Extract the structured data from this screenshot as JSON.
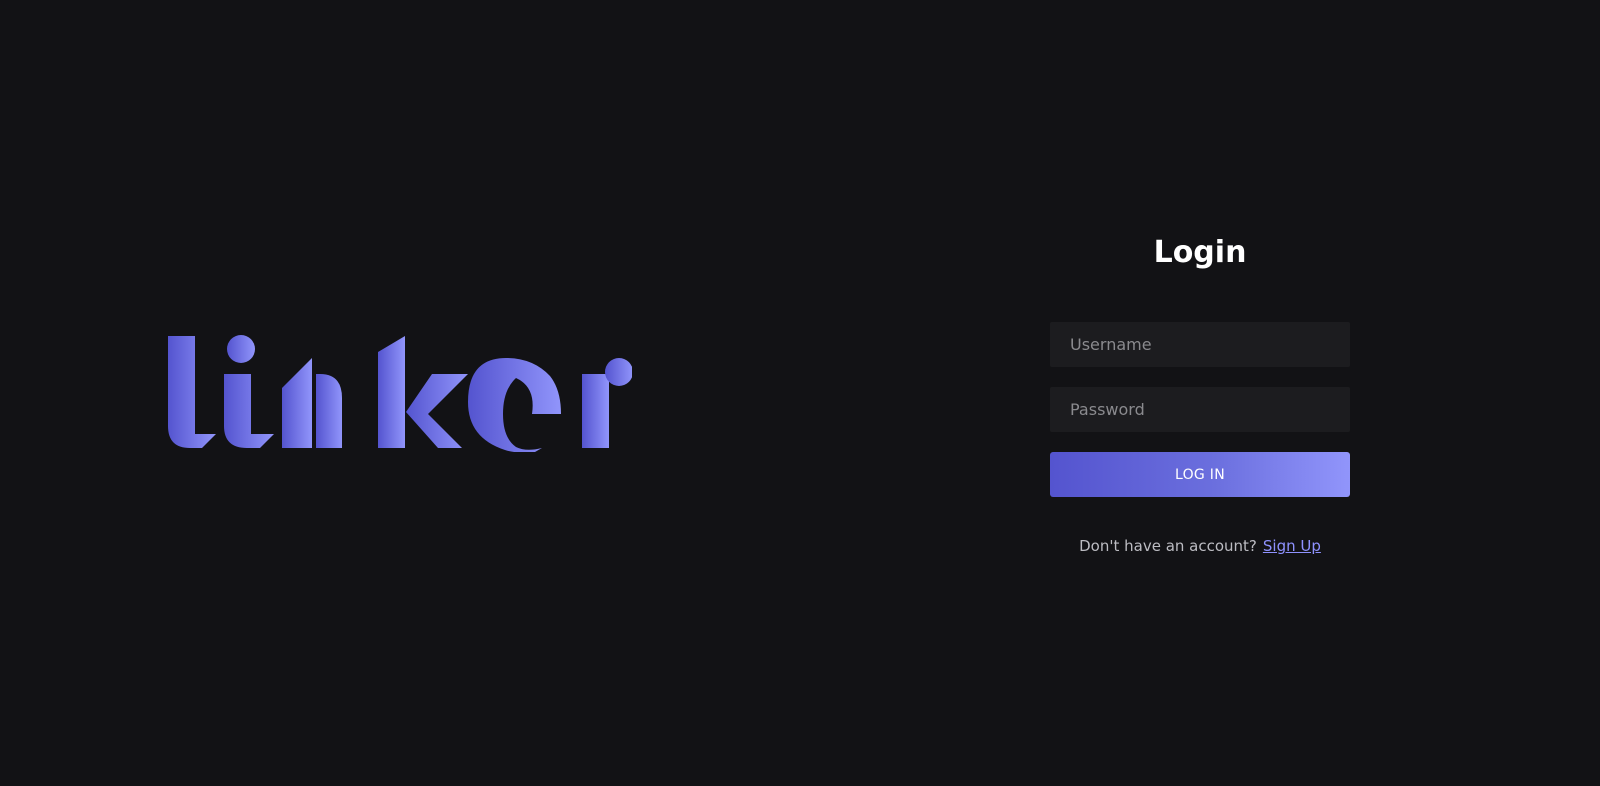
{
  "logo": {
    "text": "linker",
    "gradient_start": "#5454cf",
    "gradient_end": "#9195fb"
  },
  "login": {
    "title": "Login",
    "username_placeholder": "Username",
    "password_placeholder": "Password",
    "login_button_label": "LOG IN",
    "signup_prompt": "Don't have an account?",
    "signup_link_label": "Sign Up"
  },
  "colors": {
    "background": "#121215",
    "input_background": "#1c1c1f",
    "accent": "#8f92ff"
  }
}
